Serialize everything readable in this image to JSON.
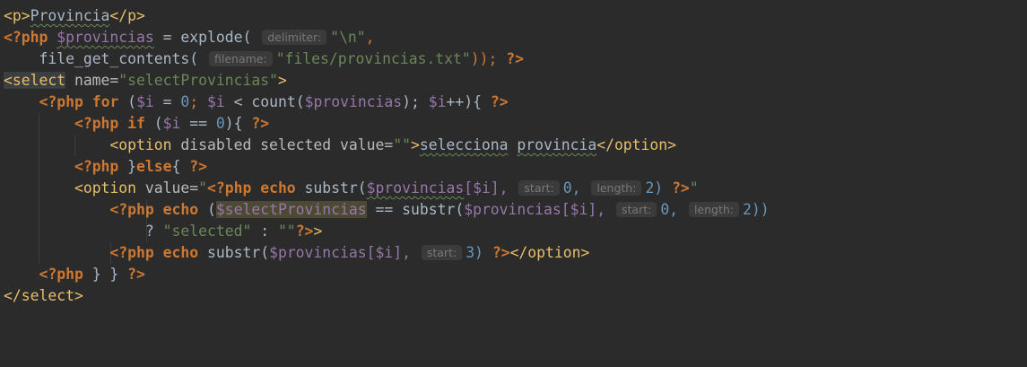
{
  "editor": {
    "language": "php",
    "theme_colors": {
      "background": "#2b2b2b",
      "tag": "#e8bf6a",
      "keyword": "#cc7832",
      "variable": "#9876aa",
      "string": "#6a8759",
      "number": "#6897bb",
      "text": "#a9b7c6"
    },
    "lines": [
      {
        "t0": "<p>",
        "t1": "Provincia",
        "t2": "</p>"
      },
      {
        "open": "<?php",
        "var": "$provincias",
        "eq": " = explode(",
        "hint": "delimiter:",
        "str": "\"\\n\"",
        "end": ","
      },
      {
        "fn": "file_get_contents(",
        "hint": "filename:",
        "str": "\"files/provincias.txt\"",
        "end": "));",
        "close": "?>"
      },
      {
        "t0": "<select",
        "attr": " name=",
        "str": "\"selectProvincias\"",
        "t1": ">"
      },
      {
        "open": "<?php",
        "kw": "for",
        "p0": " (",
        "v1": "$i",
        "p1": " = ",
        "n0": "0",
        "p2": "; ",
        "v2": "$i",
        "p3": " < count(",
        "v3": "$provincias",
        "p4": "); ",
        "v4": "$i",
        "p5": "++){",
        "close": "?>"
      },
      {
        "open": "<?php",
        "kw": "if",
        "p0": " (",
        "v1": "$i",
        "p1": " == ",
        "n0": "0",
        "p2": "){",
        "close": "?>"
      },
      {
        "t0": "<option",
        "attr": " disabled selected value=",
        "str": "\"\"",
        "t1": ">",
        "txt1": "selecciona",
        "txt2": "provincia",
        "t2": "</option>"
      },
      {
        "open": "<?php",
        "p0": " }",
        "kw": "else",
        "p1": "{",
        "close": "?>"
      },
      {
        "t0": "<option",
        "attr": " value=",
        "q": "\"",
        "open": "<?php",
        "kw": "echo",
        "fn": " substr(",
        "var": "$provincias",
        "idx": "[$i],",
        "hint1": "start:",
        "n0": "0,",
        "hint2": "length:",
        "n1": "2)",
        "close": "?>",
        "q2": "\""
      },
      {
        "open": "<?php",
        "kw": "echo",
        "p0": " (",
        "var1": "$selectProvincias",
        "p1": " == substr(",
        "var2": "$provincias",
        "idx": "[$i],",
        "hint1": "start:",
        "n0": "0,",
        "hint2": "length:",
        "n1": "2))"
      },
      {
        "p0": "? ",
        "s1": "\"selected\"",
        "p1": " : ",
        "s2": "\"\"",
        "close": "?>",
        "t0": ">"
      },
      {
        "open": "<?php",
        "kw": "echo",
        "fn": " substr(",
        "var": "$provincias",
        "idx": "[$i],",
        "hint": "start:",
        "n0": "3)",
        "close": "?>",
        "t0": "</option>"
      },
      {
        "open": "<?php",
        "p0": " } } ",
        "close": "?>"
      },
      {
        "t0": "</select>"
      }
    ]
  }
}
